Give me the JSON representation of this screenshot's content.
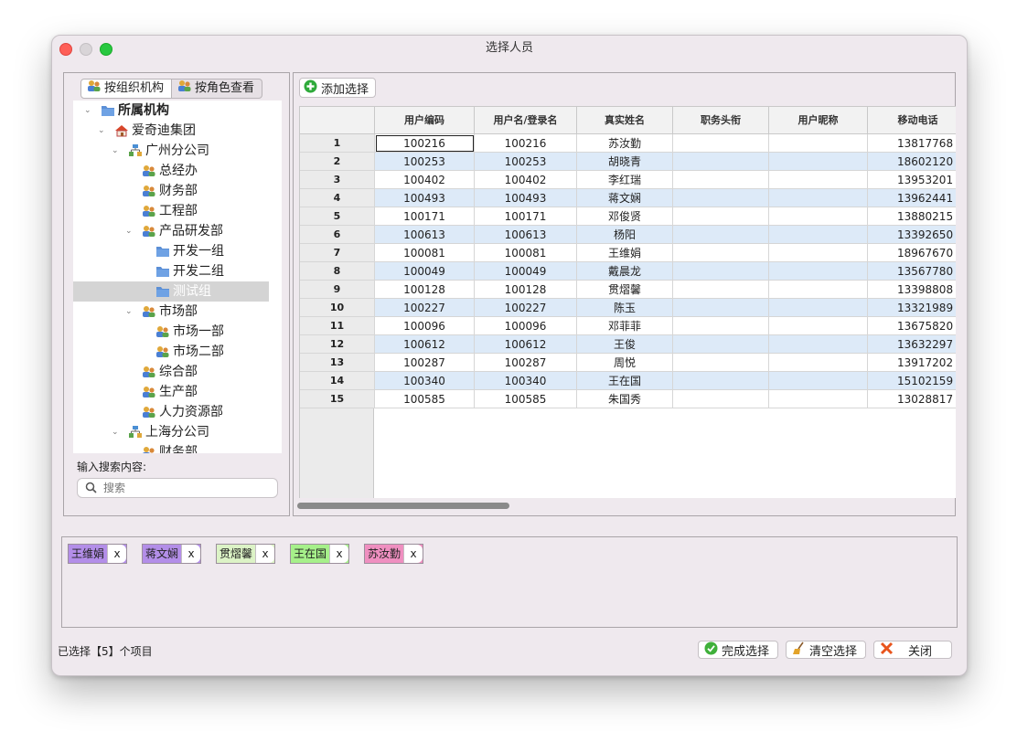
{
  "window": {
    "title": "选择人员"
  },
  "left": {
    "tabs": [
      {
        "label": "按组织机构",
        "icon": "users-icon"
      },
      {
        "label": "按角色查看",
        "icon": "users-icon"
      }
    ],
    "tree": [
      {
        "label": "所属机构",
        "icon": "folder-icon",
        "expanded": true
      },
      {
        "label": "爱奇迪集团",
        "icon": "home-icon",
        "expanded": true
      },
      {
        "label": "广州分公司",
        "icon": "org-icon",
        "expanded": true
      },
      {
        "label": "总经办",
        "icon": "users-icon"
      },
      {
        "label": "财务部",
        "icon": "users-icon"
      },
      {
        "label": "工程部",
        "icon": "users-icon"
      },
      {
        "label": "产品研发部",
        "icon": "users-icon",
        "expanded": true
      },
      {
        "label": "开发一组",
        "icon": "folder-icon"
      },
      {
        "label": "开发二组",
        "icon": "folder-icon"
      },
      {
        "label": "测试组",
        "icon": "folder-icon",
        "selected": true
      },
      {
        "label": "市场部",
        "icon": "users-icon",
        "expanded": true
      },
      {
        "label": "市场一部",
        "icon": "users-icon"
      },
      {
        "label": "市场二部",
        "icon": "users-icon"
      },
      {
        "label": "综合部",
        "icon": "users-icon"
      },
      {
        "label": "生产部",
        "icon": "users-icon"
      },
      {
        "label": "人力资源部",
        "icon": "users-icon"
      },
      {
        "label": "上海分公司",
        "icon": "org-icon",
        "expanded": true
      },
      {
        "label": "财务部",
        "icon": "users-icon"
      }
    ],
    "search_label": "输入搜索内容:",
    "search_placeholder": "搜索"
  },
  "right": {
    "add_button": "添加选择",
    "columns": [
      "用户编码",
      "用户名/登录名",
      "真实姓名",
      "职务头衔",
      "用户昵称",
      "移动电话"
    ],
    "rows": [
      {
        "n": "1",
        "code": "100216",
        "login": "100216",
        "name": "苏汝勤",
        "title": "",
        "nick": "",
        "phone": "13817768"
      },
      {
        "n": "2",
        "code": "100253",
        "login": "100253",
        "name": "胡晓青",
        "title": "",
        "nick": "",
        "phone": "18602120"
      },
      {
        "n": "3",
        "code": "100402",
        "login": "100402",
        "name": "李红瑞",
        "title": "",
        "nick": "",
        "phone": "13953201"
      },
      {
        "n": "4",
        "code": "100493",
        "login": "100493",
        "name": "蒋文娴",
        "title": "",
        "nick": "",
        "phone": "13962441"
      },
      {
        "n": "5",
        "code": "100171",
        "login": "100171",
        "name": "邓俊贤",
        "title": "",
        "nick": "",
        "phone": "13880215"
      },
      {
        "n": "6",
        "code": "100613",
        "login": "100613",
        "name": "杨阳",
        "title": "",
        "nick": "",
        "phone": "13392650"
      },
      {
        "n": "7",
        "code": "100081",
        "login": "100081",
        "name": "王维娟",
        "title": "",
        "nick": "",
        "phone": "18967670"
      },
      {
        "n": "8",
        "code": "100049",
        "login": "100049",
        "name": "戴晨龙",
        "title": "",
        "nick": "",
        "phone": "13567780"
      },
      {
        "n": "9",
        "code": "100128",
        "login": "100128",
        "name": "贯熠馨",
        "title": "",
        "nick": "",
        "phone": "13398808"
      },
      {
        "n": "10",
        "code": "100227",
        "login": "100227",
        "name": "陈玉",
        "title": "",
        "nick": "",
        "phone": "13321989"
      },
      {
        "n": "11",
        "code": "100096",
        "login": "100096",
        "name": "邓菲菲",
        "title": "",
        "nick": "",
        "phone": "13675820"
      },
      {
        "n": "12",
        "code": "100612",
        "login": "100612",
        "name": "王俊",
        "title": "",
        "nick": "",
        "phone": "13632297"
      },
      {
        "n": "13",
        "code": "100287",
        "login": "100287",
        "name": "周悦",
        "title": "",
        "nick": "",
        "phone": "13917202"
      },
      {
        "n": "14",
        "code": "100340",
        "login": "100340",
        "name": "王在国",
        "title": "",
        "nick": "",
        "phone": "15102159"
      },
      {
        "n": "15",
        "code": "100585",
        "login": "100585",
        "name": "朱国秀",
        "title": "",
        "nick": "",
        "phone": "13028817"
      }
    ]
  },
  "chips": [
    {
      "name": "王维娟",
      "color": "#b38ee8",
      "remove": "x"
    },
    {
      "name": "蒋文娴",
      "color": "#b38ee8",
      "remove": "x"
    },
    {
      "name": "贯熠馨",
      "color": "#dcf3c6",
      "remove": "x"
    },
    {
      "name": "王在国",
      "color": "#a6f08a",
      "remove": "x"
    },
    {
      "name": "苏汝勤",
      "color": "#ef8fc0",
      "remove": "x"
    }
  ],
  "footer": {
    "status": "已选择【5】个项目",
    "done": "完成选择",
    "clear": "清空选择",
    "close": "关闭"
  }
}
